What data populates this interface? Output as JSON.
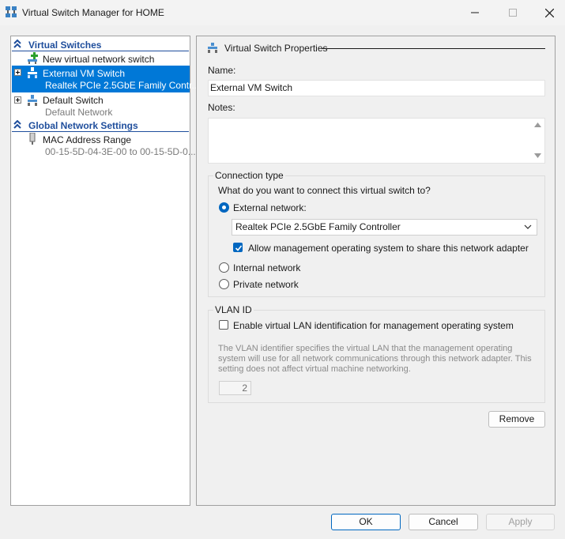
{
  "window": {
    "title": "Virtual Switch Manager for HOME",
    "icon": "virtual-switch-manager-icon"
  },
  "tree": {
    "virtual_switches_header": "Virtual Switches",
    "new_switch": "New virtual network switch",
    "switches": [
      {
        "name": "External VM Switch",
        "detail": "Realtek PCIe 2.5GbE Family Contr...",
        "selected": true
      },
      {
        "name": "Default Switch",
        "detail": "Default Network",
        "selected": false
      }
    ],
    "global_header": "Global Network Settings",
    "mac_range": {
      "name": "MAC Address Range",
      "detail": "00-15-5D-04-3E-00 to 00-15-5D-0..."
    }
  },
  "properties": {
    "header": "Virtual Switch Properties",
    "name_label": "Name:",
    "name_value": "External VM Switch",
    "notes_label": "Notes:",
    "notes_value": ""
  },
  "connection": {
    "group_title": "Connection type",
    "question": "What do you want to connect this virtual switch to?",
    "external_label": "External network:",
    "adapter_selected": "Realtek PCIe 2.5GbE Family Controller",
    "allow_mgmt_label": "Allow management operating system to share this network adapter",
    "allow_mgmt_checked": true,
    "internal_label": "Internal network",
    "private_label": "Private network",
    "selected_type": "external"
  },
  "vlan": {
    "group_title": "VLAN ID",
    "enable_label": "Enable virtual LAN identification for management operating system",
    "enable_checked": false,
    "description": "The VLAN identifier specifies the virtual LAN that the management operating system will use for all network communications through this network adapter. This setting does not affect virtual machine networking.",
    "value": "2"
  },
  "buttons": {
    "remove": "Remove",
    "ok": "OK",
    "cancel": "Cancel",
    "apply": "Apply"
  },
  "colors": {
    "selection": "#0078d7",
    "header_blue": "#1f4e9c",
    "accent": "#0067c0"
  }
}
